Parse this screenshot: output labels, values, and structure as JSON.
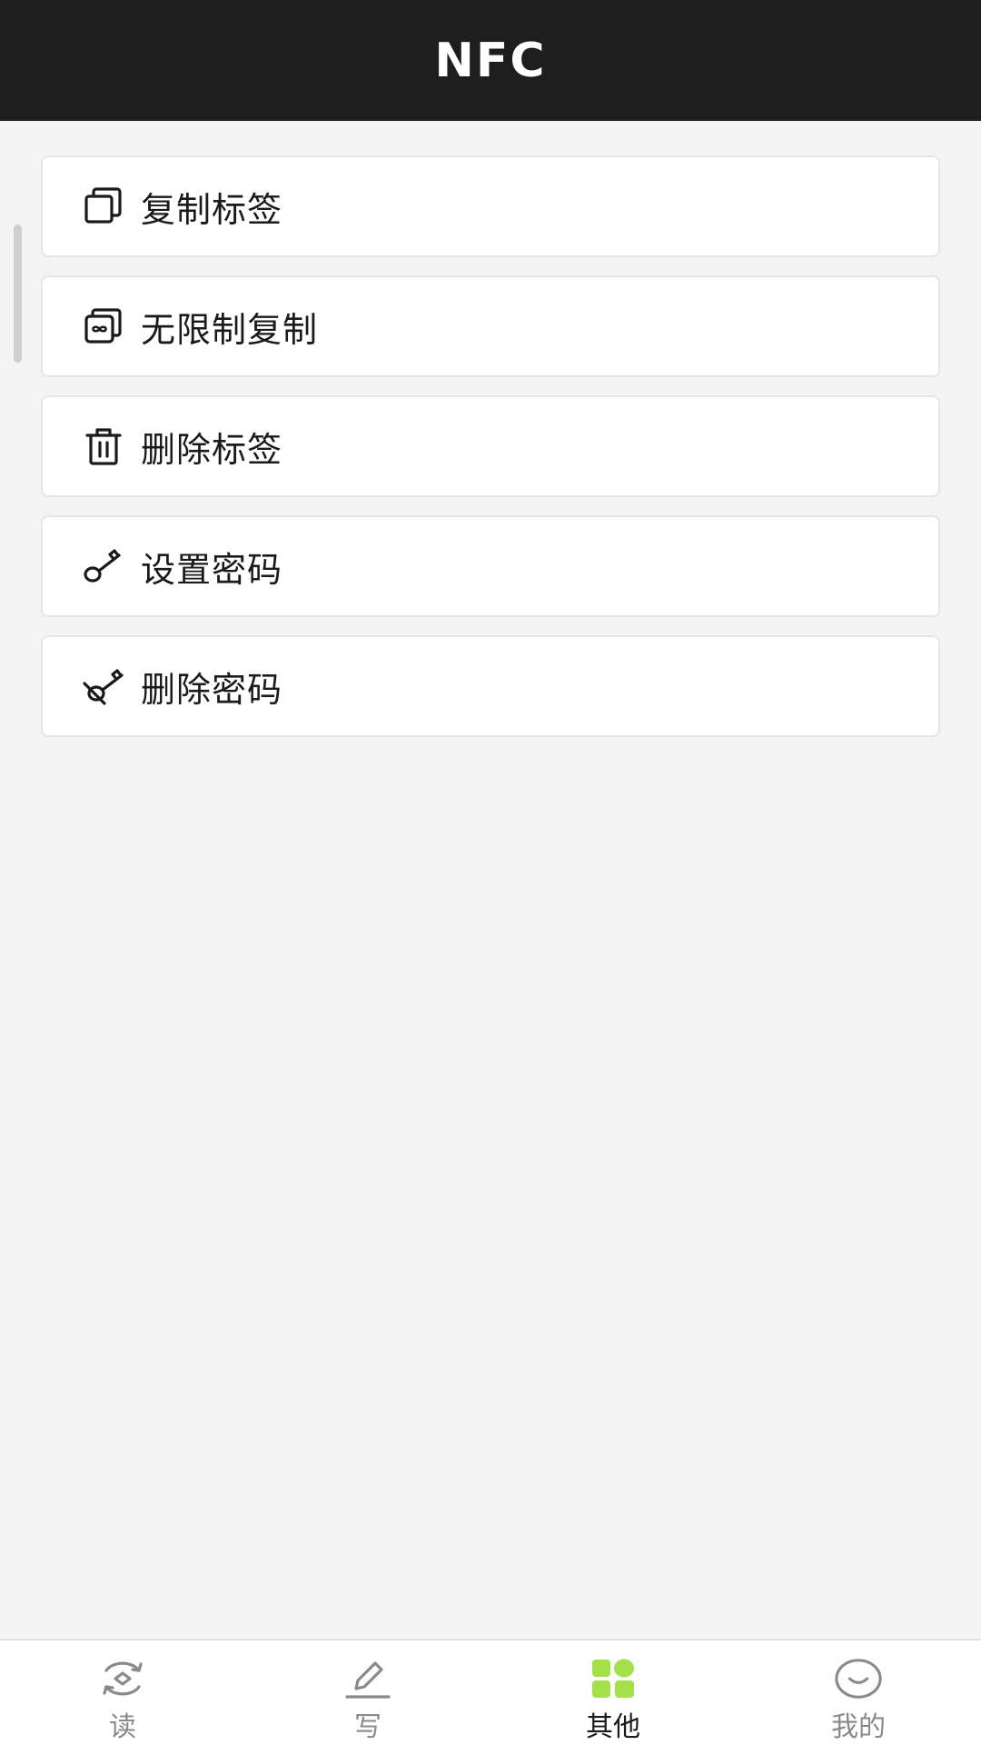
{
  "header": {
    "title": "NFC"
  },
  "menu": {
    "items": [
      {
        "label": "复制标签",
        "icon": "copy-icon"
      },
      {
        "label": "无限制复制",
        "icon": "infinite-copy-icon"
      },
      {
        "label": "删除标签",
        "icon": "trash-icon"
      },
      {
        "label": "设置密码",
        "icon": "key-icon"
      },
      {
        "label": "删除密码",
        "icon": "key-off-icon"
      }
    ]
  },
  "tabs": [
    {
      "label": "读",
      "icon": "read-eye-icon",
      "active": false
    },
    {
      "label": "写",
      "icon": "pencil-icon",
      "active": false
    },
    {
      "label": "其他",
      "icon": "grid-icon",
      "active": true
    },
    {
      "label": "我的",
      "icon": "smile-icon",
      "active": false
    }
  ],
  "colors": {
    "header_bg": "#1e1e1e",
    "page_bg": "#f4f4f4",
    "active_tab_icon": "#a3e04a",
    "inactive_tab": "#8a8a8a"
  }
}
